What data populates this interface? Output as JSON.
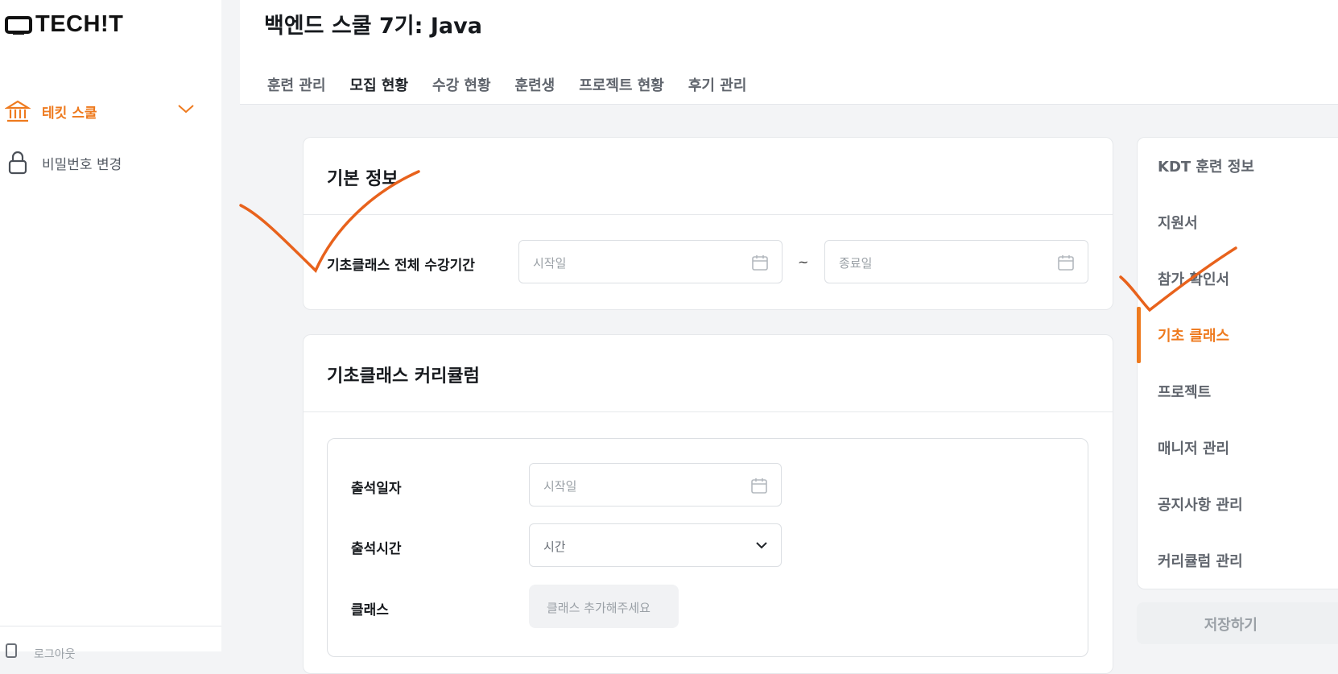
{
  "brand": {
    "logo_text": "TECH!T"
  },
  "sidebar": {
    "items": [
      {
        "label": "테킷 스쿨",
        "icon": "bank-icon",
        "active": true
      },
      {
        "label": "비밀번호 변경",
        "icon": "lock-icon",
        "active": false
      }
    ],
    "bottom_item": {
      "label": "로그아웃",
      "icon": "logout-icon"
    }
  },
  "header": {
    "title": "백엔드 스쿨 7기: Java",
    "tabs": [
      {
        "label": "훈련 관리",
        "active": false
      },
      {
        "label": "모집 현황",
        "active": true
      },
      {
        "label": "수강 현황",
        "active": false
      },
      {
        "label": "훈련생",
        "active": false
      },
      {
        "label": "프로젝트 현황",
        "active": false
      },
      {
        "label": "후기 관리",
        "active": false
      }
    ]
  },
  "basic_info": {
    "title": "기본 정보",
    "period_label": "기초클래스 전체 수강기간",
    "start_placeholder": "시작일",
    "end_placeholder": "종료일",
    "separator": "~"
  },
  "curriculum": {
    "title": "기초클래스 커리큘럼",
    "attendance_date_label": "출석일자",
    "attendance_date_placeholder": "시작일",
    "attendance_time_label": "출석시간",
    "attendance_time_placeholder": "시간",
    "class_label": "클래스",
    "class_add_placeholder": "클래스 추가해주세요"
  },
  "right_nav": {
    "items": [
      {
        "label": "KDT 훈련 정보",
        "active": false
      },
      {
        "label": "지원서",
        "active": false
      },
      {
        "label": "참가 확인서",
        "active": false
      },
      {
        "label": "기초 클래스",
        "active": true
      },
      {
        "label": "프로젝트",
        "active": false
      },
      {
        "label": "매니저 관리",
        "active": false
      },
      {
        "label": "공지사항 관리",
        "active": false
      },
      {
        "label": "커리큘럼 관리",
        "active": false
      }
    ],
    "save_label": "저장하기"
  },
  "colors": {
    "accent": "#ee7a1e",
    "annotation": "#e8621c",
    "text_primary": "#16191d",
    "text_muted": "#60656d",
    "placeholder": "#9aa0a6"
  }
}
